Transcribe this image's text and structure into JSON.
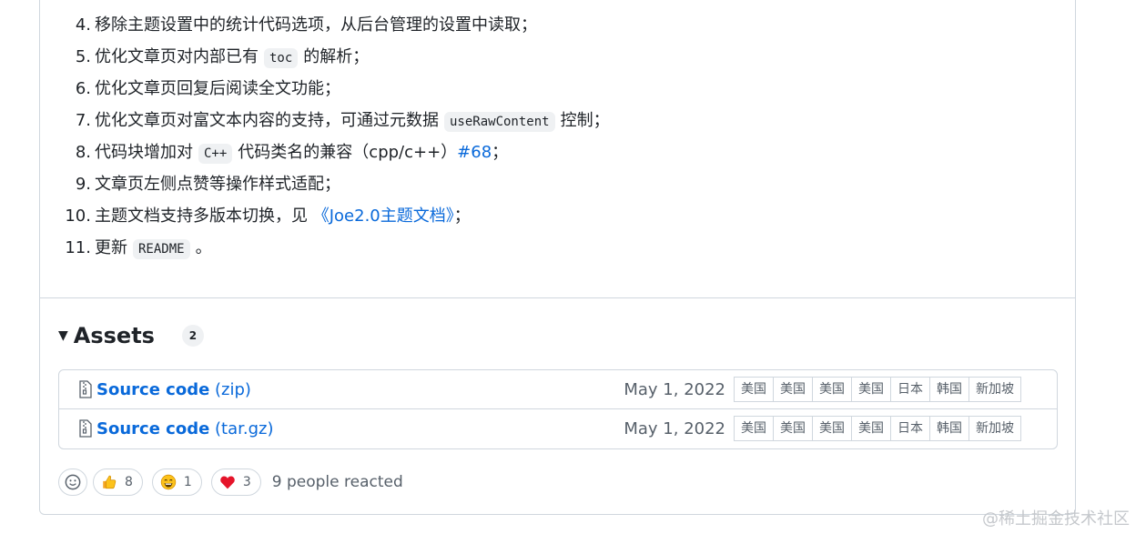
{
  "release_notes": {
    "items": [
      {
        "num": "4.",
        "parts": [
          {
            "t": "text",
            "v": "移除主题设置中的统计代码选项，从后台管理的设置中读取；"
          }
        ]
      },
      {
        "num": "5.",
        "parts": [
          {
            "t": "text",
            "v": "优化文章页对内部已有"
          },
          {
            "t": "code",
            "v": "toc"
          },
          {
            "t": "text",
            "v": "的解析；"
          }
        ]
      },
      {
        "num": "6.",
        "parts": [
          {
            "t": "text",
            "v": "优化文章页回复后阅读全文功能；"
          }
        ]
      },
      {
        "num": "7.",
        "parts": [
          {
            "t": "text",
            "v": "优化文章页对富文本内容的支持，可通过元数据"
          },
          {
            "t": "code",
            "v": "useRawContent"
          },
          {
            "t": "text",
            "v": "控制；"
          }
        ]
      },
      {
        "num": "8.",
        "parts": [
          {
            "t": "text",
            "v": "代码块增加对"
          },
          {
            "t": "code",
            "v": "C++"
          },
          {
            "t": "text",
            "v": "代码类名的兼容（cpp/c++）"
          },
          {
            "t": "link",
            "v": "#68"
          },
          {
            "t": "text",
            "v": "；"
          }
        ]
      },
      {
        "num": "9.",
        "parts": [
          {
            "t": "text",
            "v": "文章页左侧点赞等操作样式适配；"
          }
        ]
      },
      {
        "num": "10.",
        "parts": [
          {
            "t": "text",
            "v": "主题文档支持多版本切换，见 "
          },
          {
            "t": "link",
            "v": "《Joe2.0主题文档》"
          },
          {
            "t": "text",
            "v": "；"
          }
        ]
      },
      {
        "num": "11.",
        "parts": [
          {
            "t": "text",
            "v": "更新"
          },
          {
            "t": "code",
            "v": "README"
          },
          {
            "t": "text",
            "v": "。"
          }
        ]
      }
    ]
  },
  "assets": {
    "title": "Assets",
    "count": "2",
    "rows": [
      {
        "name_bold": "Source code",
        "name_suffix": " (zip)",
        "date": "May 1, 2022",
        "icon": "file-zip-icon",
        "mirrors": [
          "美国",
          "美国",
          "美国",
          "美国",
          "日本",
          "韩国",
          "新加坡"
        ]
      },
      {
        "name_bold": "Source code",
        "name_suffix": " (tar.gz)",
        "date": "May 1, 2022",
        "icon": "file-zip-icon",
        "mirrors": [
          "美国",
          "美国",
          "美国",
          "美国",
          "日本",
          "韩国",
          "新加坡"
        ]
      }
    ]
  },
  "reactions": {
    "add_icon": "smiley-icon",
    "items": [
      {
        "icon": "thumbs-up-icon",
        "count": "8"
      },
      {
        "icon": "laugh-icon",
        "count": "1"
      },
      {
        "icon": "heart-icon",
        "count": "3"
      }
    ],
    "summary": "9 people reacted"
  },
  "watermark": "@稀土掘金技术社区",
  "colors": {
    "link": "#0969da",
    "border": "#d0d7de",
    "muted": "#57606a"
  }
}
